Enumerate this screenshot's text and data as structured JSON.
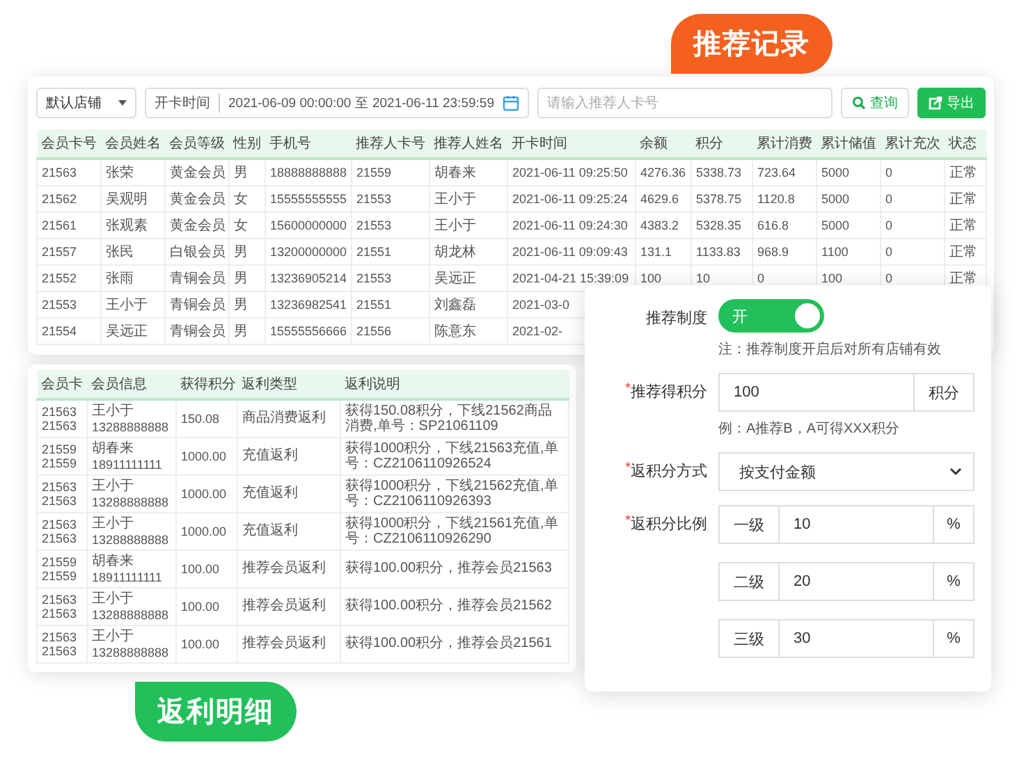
{
  "records_callout": {
    "text": "推荐记录"
  },
  "member_card": {
    "store_select": "默认店铺",
    "date_filter": {
      "label": "开卡时间",
      "range": "2021-06-09 00:00:00 至 2021-06-11 23:59:59"
    },
    "search": {
      "placeholder": "请输入推荐人卡号"
    },
    "buttons": [
      {
        "kind": "search",
        "label": "查询"
      },
      {
        "kind": "export",
        "label": "导出"
      }
    ],
    "table": {
      "columns": [
        "会员卡号",
        "会员姓名",
        "会员等级",
        "性别",
        "手机号",
        "推荐人卡号",
        "推荐人姓名",
        "开卡时间",
        "余额",
        "积分",
        "累计消费",
        "累计储值",
        "累计充次",
        "状态"
      ],
      "rows": [
        [
          "21563",
          "张荣",
          "黄金会员",
          "男",
          "18888888888",
          "21559",
          "胡春来",
          "2021-06-11 09:25:50",
          "4276.36",
          "5338.73",
          "723.64",
          "5000",
          "0",
          "正常"
        ],
        [
          "21562",
          "吴观明",
          "黄金会员",
          "女",
          "15555555555",
          "21553",
          "王小于",
          "2021-06-11 09:25:24",
          "4629.6",
          "5378.75",
          "1120.8",
          "5000",
          "0",
          "正常"
        ],
        [
          "21561",
          "张观素",
          "黄金会员",
          "女",
          "15600000000",
          "21553",
          "王小于",
          "2021-06-11 09:24:30",
          "4383.2",
          "5328.35",
          "616.8",
          "5000",
          "0",
          "正常"
        ],
        [
          "21557",
          "张民",
          "白银会员",
          "男",
          "13200000000",
          "21551",
          "胡龙林",
          "2021-06-11 09:09:43",
          "131.1",
          "1133.83",
          "968.9",
          "1100",
          "0",
          "正常"
        ],
        [
          "21552",
          "张雨",
          "青铜会员",
          "男",
          "13236905214",
          "21553",
          "吴远正",
          "2021-04-21 15:39:09",
          "100",
          "10",
          "0",
          "100",
          "0",
          "正常"
        ],
        [
          "21553",
          "王小于",
          "青铜会员",
          "男",
          "13236982541",
          "21551",
          "刘鑫磊",
          "2021-03-0"
        ],
        [
          "21554",
          "吴远正",
          "青铜会员",
          "男",
          "15555556666",
          "21556",
          "陈意东",
          "2021-02-"
        ]
      ]
    }
  },
  "rebate_card": {
    "table": {
      "columns": [
        "会员卡",
        "会员信息",
        "获得积分",
        "返利类型",
        "返利说明"
      ],
      "rows": [
        {
          "cards": [
            "21563",
            "21563"
          ],
          "name": "王小于",
          "phone": "13288888888",
          "points": "150.08",
          "type": "商品消费返利",
          "description": "获得150.08积分，下线21562商品消费,单号：SP21061109"
        },
        {
          "cards": [
            "21559",
            "21559"
          ],
          "name": "胡春来",
          "phone": "18911111111",
          "points": "1000.00",
          "type": "充值返利",
          "description": "获得1000积分，下线21563充值,单号：CZ2106110926524"
        },
        {
          "cards": [
            "21563",
            "21563"
          ],
          "name": "王小于",
          "phone": "13288888888",
          "points": "1000.00",
          "type": "充值返利",
          "description": "获得1000积分，下线21562充值,单号：CZ2106110926393"
        },
        {
          "cards": [
            "21563",
            "21563"
          ],
          "name": "王小于",
          "phone": "13288888888",
          "points": "1000.00",
          "type": "充值返利",
          "description": "获得1000积分，下线21561充值,单号：CZ2106110926290"
        },
        {
          "cards": [
            "21559",
            "21559"
          ],
          "name": "胡春来",
          "phone": "18911111111",
          "points": "100.00",
          "type": "推荐会员返利",
          "description": "获得100.00积分，推荐会员21563"
        },
        {
          "cards": [
            "21563",
            "21563"
          ],
          "name": "王小于",
          "phone": "13288888888",
          "points": "100.00",
          "type": "推荐会员返利",
          "description": "获得100.00积分，推荐会员21562"
        },
        {
          "cards": [
            "21563",
            "21563"
          ],
          "name": "王小于",
          "phone": "13288888888",
          "points": "100.00",
          "type": "推荐会员返利",
          "description": "获得100.00积分，推荐会员21561"
        }
      ]
    }
  },
  "rebate_callout": {
    "text": "返利明细"
  },
  "settings_panel": {
    "referral": {
      "label": "推荐制度",
      "on": true,
      "toggle_text": "开",
      "note": "注：推荐制度开启后对所有店铺有效"
    },
    "points": {
      "mark": "*",
      "label": "推荐得积分",
      "value": "100",
      "unit": "积分",
      "hint": "例：A推荐B，A可得XXX积分"
    },
    "method": {
      "mark": "*",
      "label": "返积分方式",
      "value": "按支付金额"
    },
    "ratio": {
      "mark": "*",
      "label": "返积分比例",
      "levels": [
        {
          "label": "一级",
          "value": "10",
          "unit": "%"
        },
        {
          "label": "二级",
          "value": "20",
          "unit": "%"
        },
        {
          "label": "三级",
          "value": "30",
          "unit": "%"
        }
      ]
    }
  }
}
